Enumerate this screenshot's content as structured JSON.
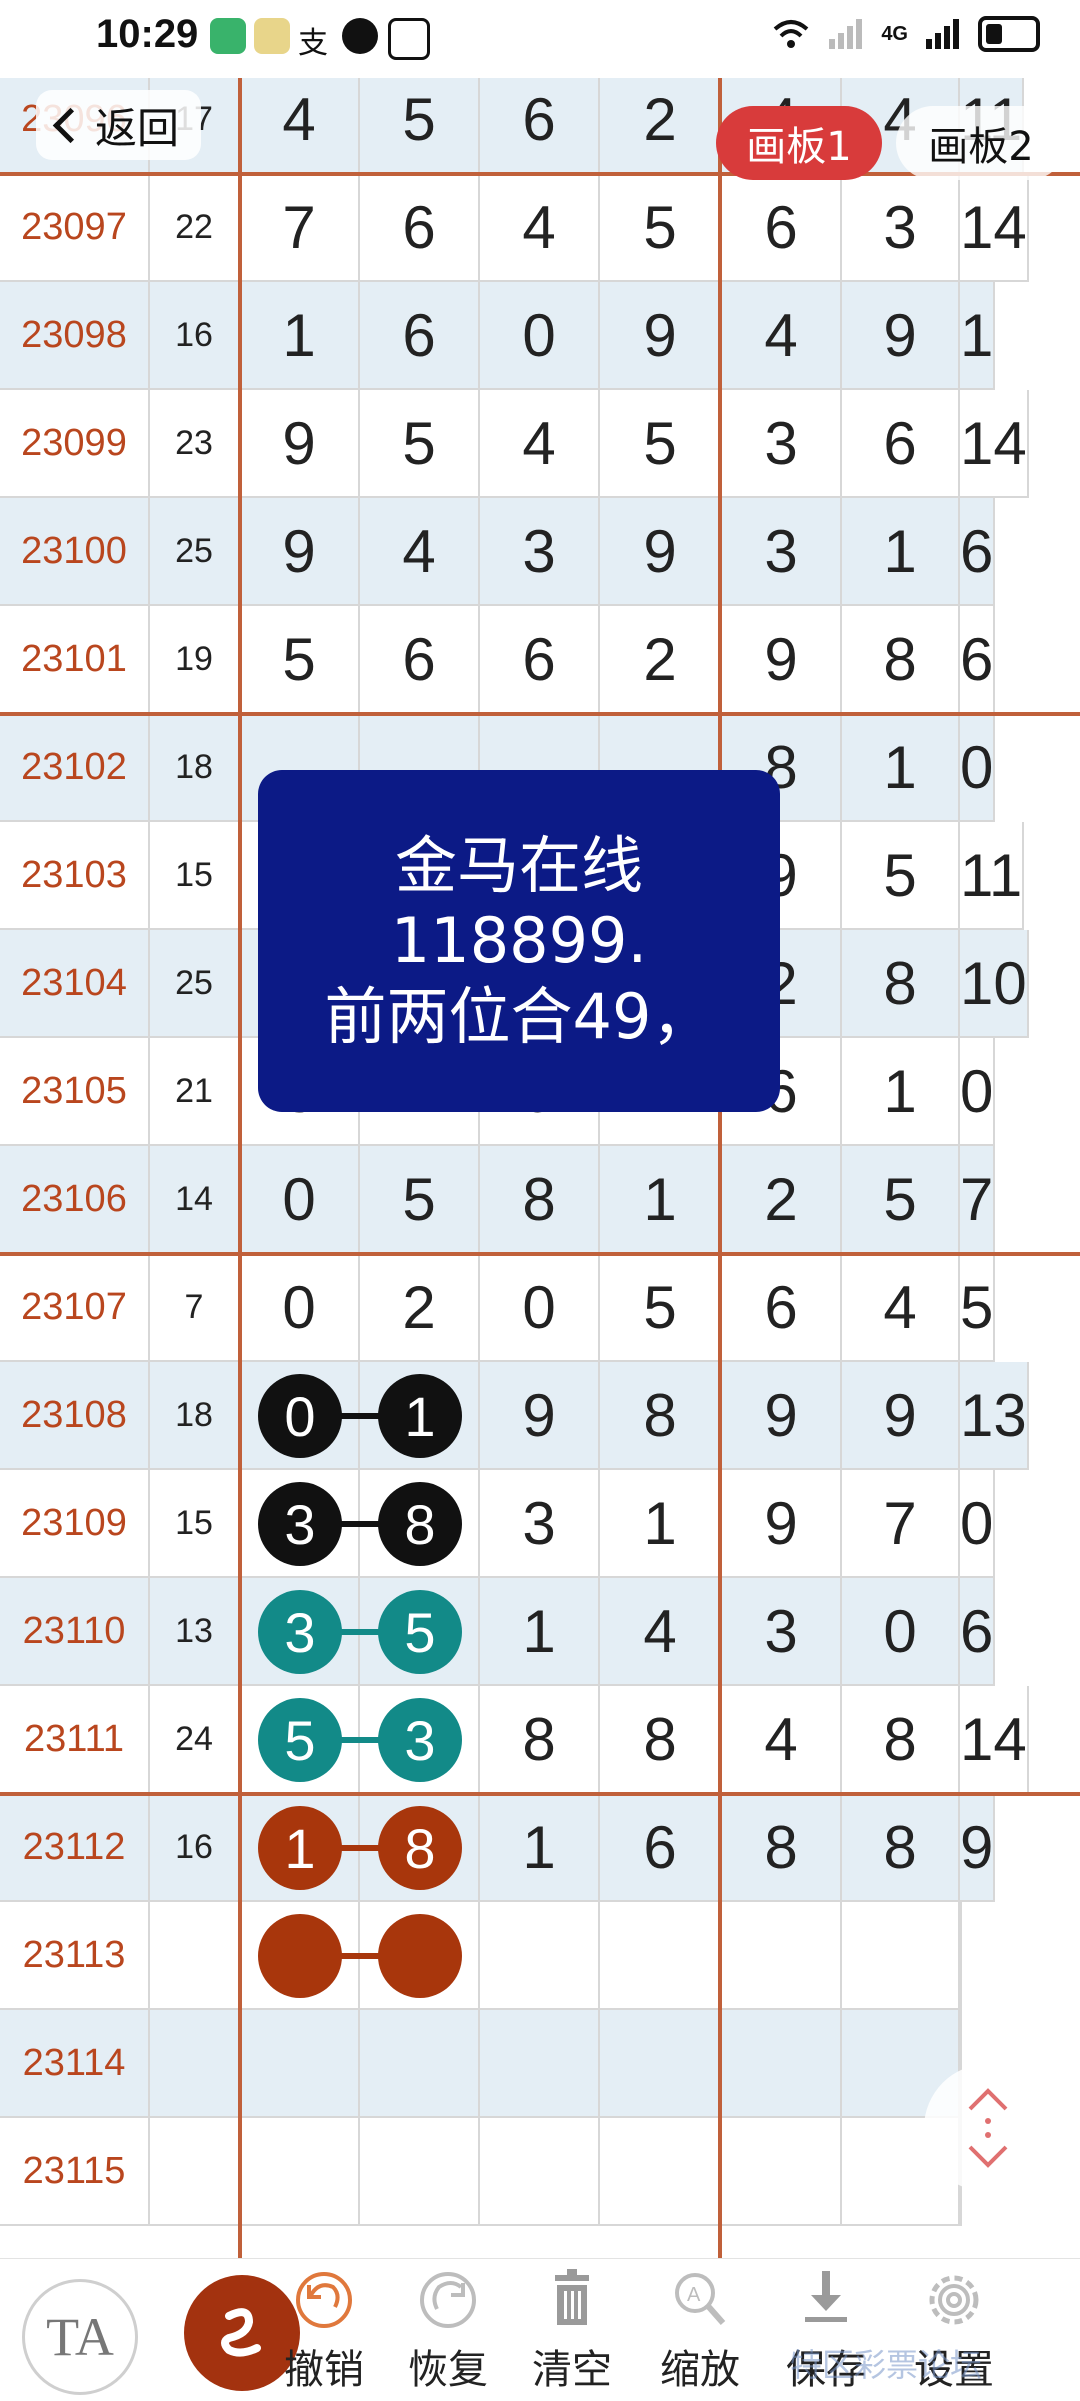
{
  "status_bar": {
    "time": "10:29",
    "network": "4G"
  },
  "nav": {
    "back_label": "返回",
    "tabs": [
      "画板1",
      "画板2"
    ],
    "active_tab": 0
  },
  "overlay": {
    "lines": [
      "金马在线",
      "118899.",
      "前两位合49，"
    ]
  },
  "rows": [
    {
      "issue": "23096",
      "sum": "17",
      "digits": [
        "4",
        "5",
        "6",
        "2",
        "4",
        "4",
        "11"
      ]
    },
    {
      "issue": "23097",
      "sum": "22",
      "digits": [
        "7",
        "6",
        "4",
        "5",
        "6",
        "3",
        "14"
      ]
    },
    {
      "issue": "23098",
      "sum": "16",
      "digits": [
        "1",
        "6",
        "0",
        "9",
        "4",
        "9",
        "1"
      ]
    },
    {
      "issue": "23099",
      "sum": "23",
      "digits": [
        "9",
        "5",
        "4",
        "5",
        "3",
        "6",
        "14"
      ]
    },
    {
      "issue": "23100",
      "sum": "25",
      "digits": [
        "9",
        "4",
        "3",
        "9",
        "3",
        "1",
        "6"
      ]
    },
    {
      "issue": "23101",
      "sum": "19",
      "digits": [
        "5",
        "6",
        "6",
        "2",
        "9",
        "8",
        "6"
      ]
    },
    {
      "issue": "23102",
      "sum": "18",
      "digits": [
        "",
        "",
        "",
        "",
        "8",
        "1",
        "0"
      ]
    },
    {
      "issue": "23103",
      "sum": "15",
      "digits": [
        "",
        "",
        "",
        "",
        "9",
        "5",
        "11"
      ]
    },
    {
      "issue": "23104",
      "sum": "25",
      "digits": [
        "",
        "",
        "",
        "",
        "2",
        "8",
        "10"
      ]
    },
    {
      "issue": "23105",
      "sum": "21",
      "digits": [
        "3",
        "2",
        "9",
        "7",
        "6",
        "1",
        "0"
      ]
    },
    {
      "issue": "23106",
      "sum": "14",
      "digits": [
        "0",
        "5",
        "8",
        "1",
        "2",
        "5",
        "7"
      ]
    },
    {
      "issue": "23107",
      "sum": "7",
      "digits": [
        "0",
        "2",
        "0",
        "5",
        "6",
        "4",
        "5"
      ]
    },
    {
      "issue": "23108",
      "sum": "18",
      "digits": [
        "0",
        "1",
        "9",
        "8",
        "9",
        "9",
        "13"
      ]
    },
    {
      "issue": "23109",
      "sum": "15",
      "digits": [
        "3",
        "8",
        "3",
        "1",
        "9",
        "7",
        "0"
      ]
    },
    {
      "issue": "23110",
      "sum": "13",
      "digits": [
        "3",
        "5",
        "1",
        "4",
        "3",
        "0",
        "6"
      ]
    },
    {
      "issue": "23111",
      "sum": "24",
      "digits": [
        "5",
        "3",
        "8",
        "8",
        "4",
        "8",
        "14"
      ]
    },
    {
      "issue": "23112",
      "sum": "16",
      "digits": [
        "1",
        "8",
        "1",
        "6",
        "8",
        "8",
        "9"
      ]
    },
    {
      "issue": "23113",
      "sum": "",
      "digits": [
        "",
        "",
        "",
        "",
        "",
        "",
        ""
      ]
    },
    {
      "issue": "23114",
      "sum": "",
      "digits": [
        "",
        "",
        "",
        "",
        "",
        "",
        ""
      ]
    },
    {
      "issue": "23115",
      "sum": "",
      "digits": [
        "",
        "",
        "",
        "",
        "",
        "",
        ""
      ]
    }
  ],
  "marked_pairs": [
    {
      "row": 12,
      "values": [
        "0",
        "1"
      ],
      "color": "#111111"
    },
    {
      "row": 13,
      "values": [
        "3",
        "8"
      ],
      "color": "#111111"
    },
    {
      "row": 14,
      "values": [
        "3",
        "5"
      ],
      "color": "#128a88"
    },
    {
      "row": 15,
      "values": [
        "5",
        "3"
      ],
      "color": "#128a88"
    },
    {
      "row": 16,
      "values": [
        "1",
        "8"
      ],
      "color": "#a8360c"
    },
    {
      "row": 17,
      "values": [
        "",
        ""
      ],
      "color": "#a8360c"
    }
  ],
  "toolbar": {
    "ta_label": "TA",
    "items": [
      {
        "label": "撤销",
        "icon": "undo-icon"
      },
      {
        "label": "恢复",
        "icon": "redo-icon"
      },
      {
        "label": "清空",
        "icon": "trash-icon"
      },
      {
        "label": "缩放",
        "icon": "zoom-icon"
      },
      {
        "label": "保存",
        "icon": "download-icon"
      },
      {
        "label": "设置",
        "icon": "gear-icon"
      }
    ]
  },
  "watermark": "特区彩票论坛",
  "colors": {
    "accent": "#c0603a",
    "issue_text": "#b9461e",
    "alt_row": "#e4eef5",
    "overlay_bg": "#0c1a86",
    "active_tab": "#d83b3b"
  }
}
